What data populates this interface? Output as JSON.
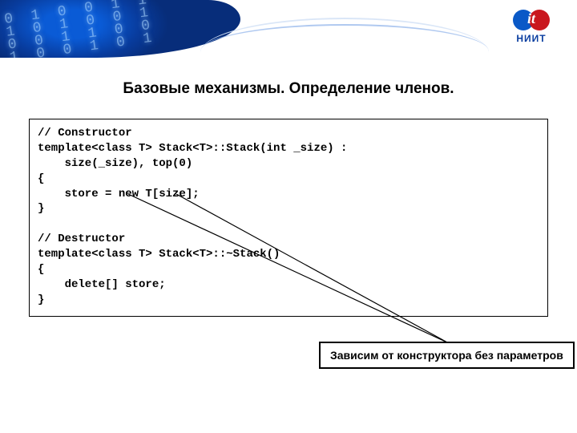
{
  "header": {
    "logo_text": "it",
    "logo_subtitle": "НИИТ",
    "bg_digits": "0 1 0 0 1 1\n1 0 1 0 0 1\n0 0 1 1 0 0\n1 0 0 1 0 1"
  },
  "slide": {
    "title": "Базовые механизмы. Определение членов."
  },
  "code": {
    "block": "// Constructor\ntemplate<class T> Stack<T>::Stack(int _size) :\n    size(_size), top(0)\n{\n    store = new T[size];\n}\n\n// Destructor\ntemplate<class T> Stack<T>::~Stack()\n{\n    delete[] store;\n}"
  },
  "callout": {
    "text": "Зависим от конструктора без параметров"
  }
}
